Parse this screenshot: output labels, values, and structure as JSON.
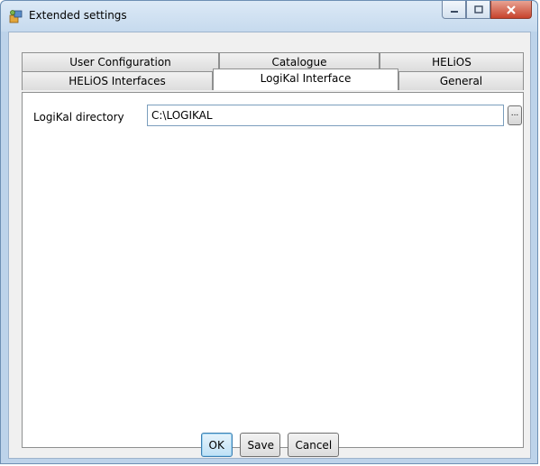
{
  "window": {
    "title": "Extended settings",
    "app_icon": "settings-app-icon",
    "caption_buttons": [
      "minimize-icon",
      "maximize-icon",
      "close-icon"
    ]
  },
  "tabs": {
    "top_row": [
      "User Configuration",
      "Catalogue",
      "HELiOS"
    ],
    "bottom_row": [
      "HELiOS Interfaces",
      "LogiKal Interface",
      "General"
    ],
    "selected": "LogiKal Interface"
  },
  "panel": {
    "field_label": "LogiKal directory",
    "field_value": "C:\\LOGIKAL",
    "browse_label": "..."
  },
  "buttons": {
    "ok": "OK",
    "save": "Save",
    "cancel": "Cancel"
  },
  "colors": {
    "titlebar": "#c6daee",
    "close_button": "#c7432c",
    "default_button_border": "#3c7fb1"
  }
}
